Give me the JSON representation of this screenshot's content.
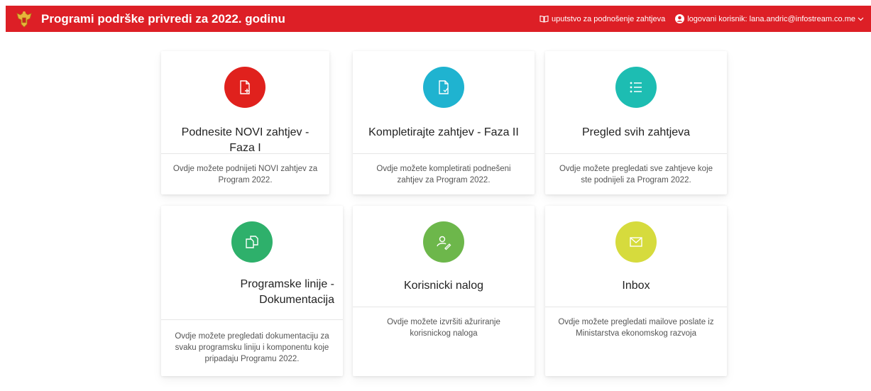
{
  "header": {
    "title": "Programi podrške privredi za 2022. godinu",
    "logo_icon": "montenegro-coat-of-arms",
    "guide_link": "uputstvo za podnošenje zahtjeva",
    "guide_icon": "book-icon",
    "user_label": "logovani korisnik: lana.andric@infostream.co.me",
    "user_icon": "user-icon",
    "dropdown_icon": "chevron-down-icon"
  },
  "cards": [
    {
      "title": "Podnesite NOVI zahtjev - Faza I",
      "description": "Ovdje možete podnijeti NOVI zahtjev za Program 2022.",
      "icon": "file-add-icon",
      "color": "#e0211d"
    },
    {
      "title": "Kompletirajte zahtjev - Faza II",
      "description": "Ovdje možete kompletirati podnešeni zahtjev za Program 2022.",
      "icon": "file-check-icon",
      "color": "#1fb3d0"
    },
    {
      "title": "Pregled svih zahtjeva",
      "description": "Ovdje možete pregledati sve zahtjeve koje ste podnijeli za Program 2022.",
      "icon": "list-icon",
      "color": "#1dbdb2"
    },
    {
      "title": "Programske linije - Dokumentacija",
      "description": "Ovdje možete pregledati dokumentaciju za svaku programsku liniju i komponentu koje pripadaju Programu 2022.",
      "icon": "copy-documents-icon",
      "color": "#2eb06b"
    },
    {
      "title": "Korisnicki nalog",
      "description": "Ovdje možete izvršiti ažuriranje korisnickog naloga",
      "icon": "user-edit-icon",
      "color": "#6db74b"
    },
    {
      "title": "Inbox",
      "description": "Ovdje možete pregledati mailove poslate iz Ministarstva ekonomskog razvoja",
      "icon": "mail-icon",
      "color": "#d6db3d"
    }
  ]
}
